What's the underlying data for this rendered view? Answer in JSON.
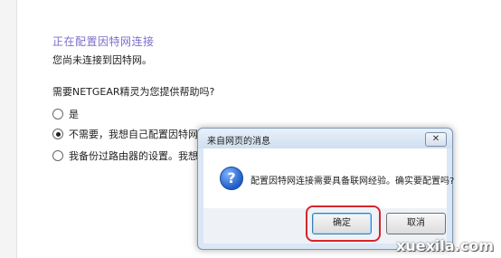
{
  "page": {
    "heading": "正在配置因特网连接",
    "subtext": "您尚未连接到因特网。",
    "question": "需要NETGEAR精灵为您提供帮助吗?",
    "options": [
      {
        "label": "是",
        "checked": false
      },
      {
        "label": "不需要，我想自己配置因特网连",
        "checked": true
      },
      {
        "label": "我备份过路由器的设置。我想",
        "checked": false
      }
    ]
  },
  "dialog": {
    "title": "来自网页的消息",
    "close_label": "✕",
    "message": "配置因特网连接需要具备联网经验。确实要配置吗?",
    "ok_label": "确定",
    "cancel_label": "取消",
    "icon": "question-icon"
  },
  "watermark": "xuexila.com",
  "colors": {
    "heading": "#7b6fc9",
    "highlight": "#d8242b"
  }
}
